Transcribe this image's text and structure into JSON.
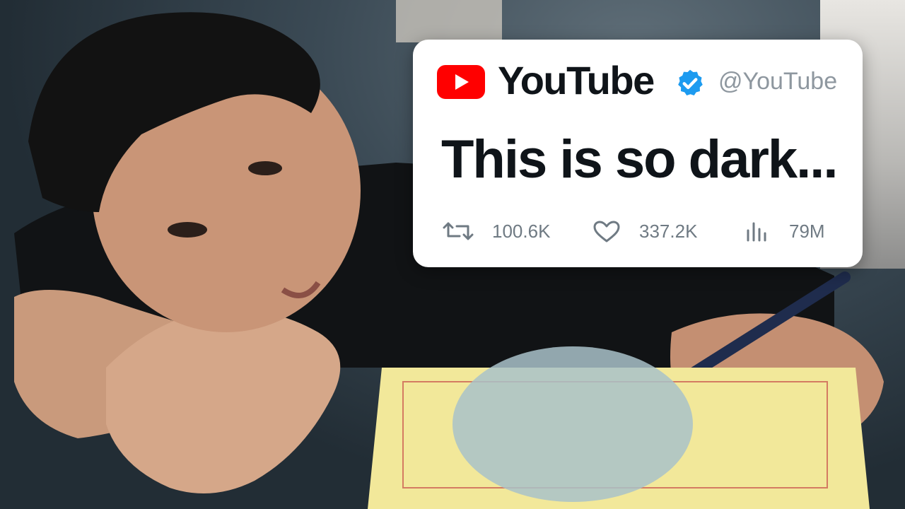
{
  "post": {
    "author_name": "YouTube",
    "handle": "@YouTube",
    "text": "This is so dark...",
    "metrics": {
      "retweets": "100.6K",
      "likes": "337.2K",
      "views": "79M"
    }
  },
  "colors": {
    "logo_red": "#ff0000",
    "verified_blue": "#1d9bf0",
    "card_bg": "#ffffff",
    "text_primary": "#0f1419",
    "text_muted": "#8e979f"
  },
  "icons": [
    "youtube-logo-icon",
    "verified-badge-icon",
    "retweet-icon",
    "heart-icon",
    "views-chart-icon"
  ]
}
